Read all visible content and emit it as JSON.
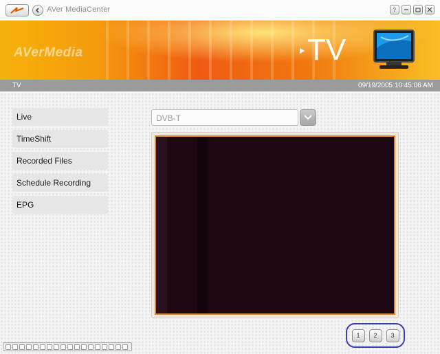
{
  "titlebar": {
    "app_title": "AVer MediaCenter",
    "window_buttons": [
      "?",
      "—",
      "▭",
      "✕"
    ]
  },
  "banner": {
    "brand": "AVerMedia",
    "section_title": "TV"
  },
  "statusbar": {
    "section": "TV",
    "datetime": "09/19/2005 10:45:06 AM"
  },
  "menu": {
    "items": [
      {
        "label": "Live"
      },
      {
        "label": "TimeShift"
      },
      {
        "label": "Recorded Files"
      },
      {
        "label": "Schedule Recording"
      },
      {
        "label": "EPG"
      }
    ]
  },
  "source": {
    "selected": "DVB-T"
  },
  "pager": {
    "buttons": [
      "1",
      "2",
      "3"
    ]
  },
  "colors": {
    "banner_orange": "#ef5a12",
    "banner_yellow": "#f6b20a",
    "statusbar_gray": "#9b9b9b",
    "video_border": "#d4863c",
    "video_bg": "#1c0712",
    "pager_highlight": "#3b3fb4"
  }
}
